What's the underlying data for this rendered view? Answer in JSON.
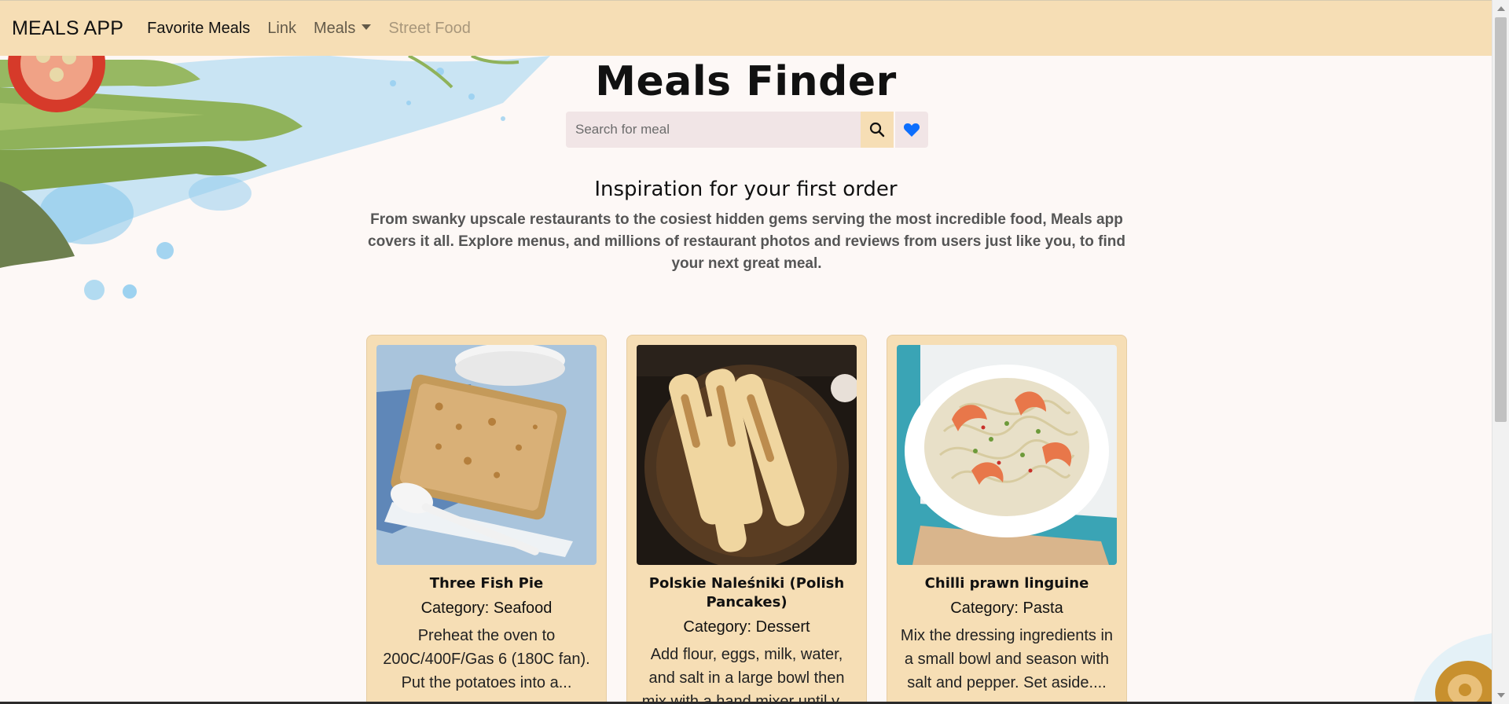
{
  "navbar": {
    "brand": "MEALS APP",
    "links": [
      "Favorite Meals",
      "Link",
      "Meals",
      "Street Food"
    ]
  },
  "hero": {
    "title": "Meals Finder",
    "search_placeholder": "Search for meal"
  },
  "intro": {
    "heading": "Inspiration for your first order",
    "text": "From swanky upscale restaurants to the cosiest hidden gems serving the most incredible food, Meals app covers it all. Explore menus, and millions of restaurant photos and reviews from users just like you, to find your next great meal."
  },
  "cards": [
    {
      "title": "Three Fish Pie",
      "category": "Category: Seafood",
      "description": "Preheat the oven to 200C/400F/Gas 6 (180C fan). Put the potatoes into a..."
    },
    {
      "title": "Polskie Naleśniki (Polish Pancakes)",
      "category": "Category: Dessert",
      "description": "Add flour, eggs, milk, water, and salt in a large bowl then mix with a hand mixer until y..."
    },
    {
      "title": "Chilli prawn linguine",
      "category": "Category: Pasta",
      "description": "Mix the dressing ingredients in a small bowl and season with salt and pepper. Set aside...."
    }
  ],
  "colors": {
    "navbar": "#f6deb5",
    "card": "#f6deb5",
    "background": "#fdf8f6",
    "heart": "#0d6efd"
  }
}
